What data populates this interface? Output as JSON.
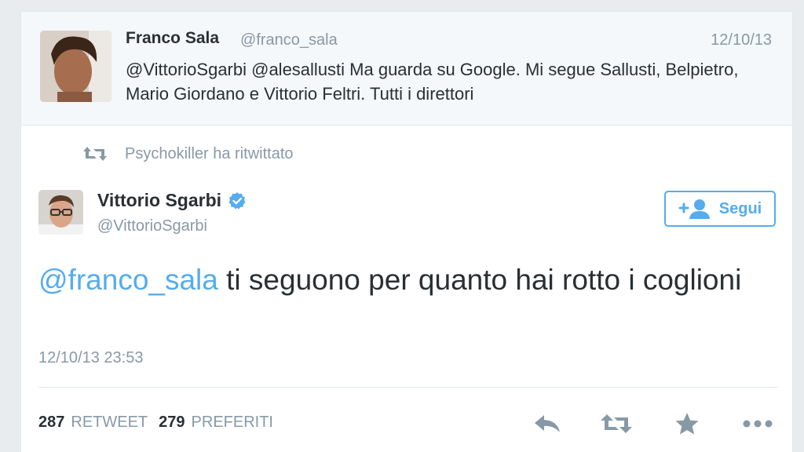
{
  "first_tweet": {
    "name": "Franco Sala",
    "handle": "@franco_sala",
    "date": "12/10/13",
    "text": "@VittorioSgarbi  @alesallusti Ma guarda su Google. Mi segue Sallusti, Belpietro, Mario Giordano e Vittorio Feltri. Tutti i direttori"
  },
  "retweet_line": {
    "text": "Psychokiller ha ritwittato",
    "icon": "retweet-icon"
  },
  "main_tweet": {
    "name": "Vittorio Sgarbi",
    "handle": "@VittorioSgarbi",
    "verified_icon": "verified-badge-icon",
    "follow_label": "Segui",
    "follow_icon": "add-user-icon",
    "mention": "@franco_sala",
    "text": " ti seguono per quanto hai rotto i coglioni",
    "timestamp": "12/10/13 23:53"
  },
  "stats": {
    "retweets_count": "287",
    "retweets_label": "RETWEET",
    "favorites_count": "279",
    "favorites_label": "PREFERITI"
  },
  "actions": [
    "reply-icon",
    "retweet-icon",
    "favorite-star-icon",
    "more-options-icon"
  ],
  "colors": {
    "accent": "#55acee",
    "muted": "#8899a6",
    "text": "#292f33",
    "background": "#e9ecee"
  }
}
